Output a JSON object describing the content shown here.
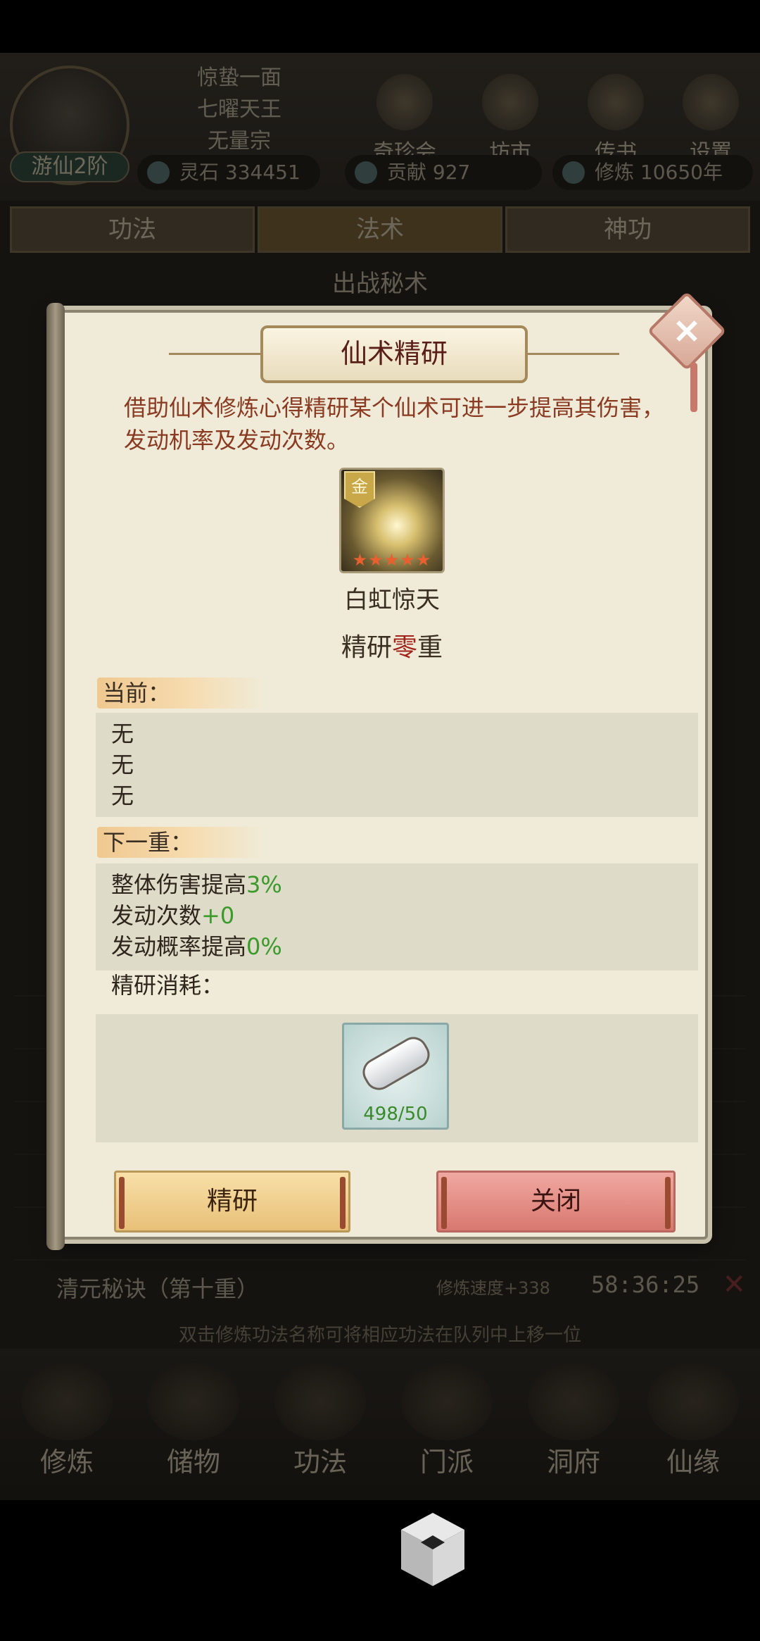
{
  "header": {
    "titles": [
      "惊蛰一面",
      "七曜天王",
      "无量宗"
    ],
    "realm": "游仙2阶",
    "icons": [
      {
        "label": "奇珍会",
        "icon": "treasure-icon"
      },
      {
        "label": "坊市",
        "icon": "market-icon"
      },
      {
        "label": "传书",
        "icon": "letter-icon"
      },
      {
        "label": "设置",
        "icon": "gear-icon"
      }
    ],
    "resources": {
      "lingshi": "灵石 334451",
      "gongxian": "贡献 927",
      "xiulian": "修炼 10650年"
    }
  },
  "tabs": [
    "功法",
    "法术",
    "神功"
  ],
  "section_title": "出战秘术",
  "bottom_row": {
    "name": "清元秘诀（第十重）",
    "speed": "修炼速度+338",
    "timer": "58:36:25",
    "remove": "✕"
  },
  "hint": "双击修炼功法名称可将相应功法在队列中上移一位",
  "nav": [
    "修炼",
    "储物",
    "功法",
    "门派",
    "洞府",
    "仙缘"
  ],
  "modal": {
    "title": "仙术精研",
    "description": "借助仙术修炼心得精研某个仙术可进一步提高其伤害，发动机率及发动次数。",
    "skill": {
      "grade": "金",
      "stars": "★★★★★",
      "name": "白虹惊天"
    },
    "level_prefix": "精研",
    "level_value": "零",
    "level_suffix": "重",
    "current_label": "当前：",
    "current_lines": [
      "无",
      "无",
      "无"
    ],
    "next_label": "下一重：",
    "next": [
      {
        "text": "整体伤害提高",
        "value": "3%"
      },
      {
        "text": "发动次数",
        "value": "+0"
      },
      {
        "text": "发动概率提高",
        "value": "0%"
      }
    ],
    "cost_label": "精研消耗：",
    "cost_item_count": "498/50",
    "btn_refine": "精研",
    "btn_close": "关闭"
  }
}
